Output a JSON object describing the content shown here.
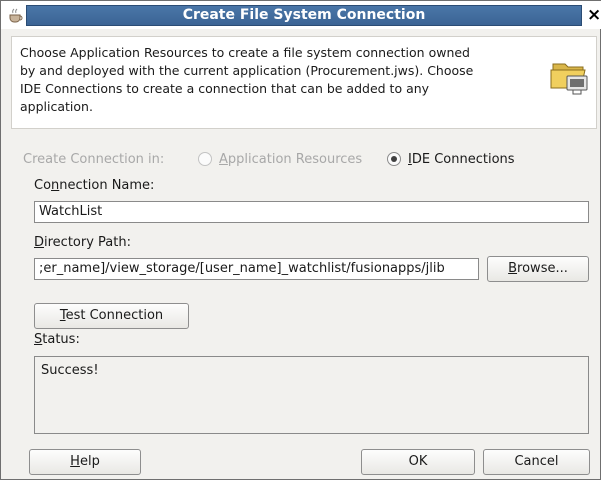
{
  "window": {
    "title": "Create File System Connection",
    "close_glyph": "×"
  },
  "header": {
    "description_lines": [
      "Choose Application Resources to create a file system connection owned",
      "by and deployed with the current application (Procurement.jws). Choose",
      "IDE Connections to create a connection that can be added to any",
      "application."
    ],
    "icon": "folder-connection-icon"
  },
  "create_in": {
    "label": "Create Connection in:",
    "options": [
      {
        "label_mnemonic": "A",
        "label_rest": "pplication Resources",
        "selected": false,
        "enabled": false
      },
      {
        "label_mnemonic": "I",
        "label_rest": "DE Connections",
        "selected": true,
        "enabled": true
      }
    ]
  },
  "connection_name": {
    "label_pre": "Co",
    "label_mnemonic": "n",
    "label_post": "nection Name:",
    "value": "WatchList"
  },
  "directory_path": {
    "label_mnemonic": "D",
    "label_rest": "irectory Path:",
    "value": ";er_name]/view_storage/[user_name]_watchlist/fusionapps/jlib",
    "browse_mnemonic": "B",
    "browse_rest": "rowse..."
  },
  "test_connection": {
    "label_mnemonic": "T",
    "label_rest": "est Connection"
  },
  "status": {
    "label_mnemonic": "S",
    "label_rest": "tatus:",
    "text": "Success!"
  },
  "footer": {
    "help_mnemonic": "H",
    "help_rest": "elp",
    "ok_label": "OK",
    "cancel_label": "Cancel"
  },
  "colors": {
    "title_bar": "#3b6494",
    "dialog_bg": "#f2f1ee"
  }
}
